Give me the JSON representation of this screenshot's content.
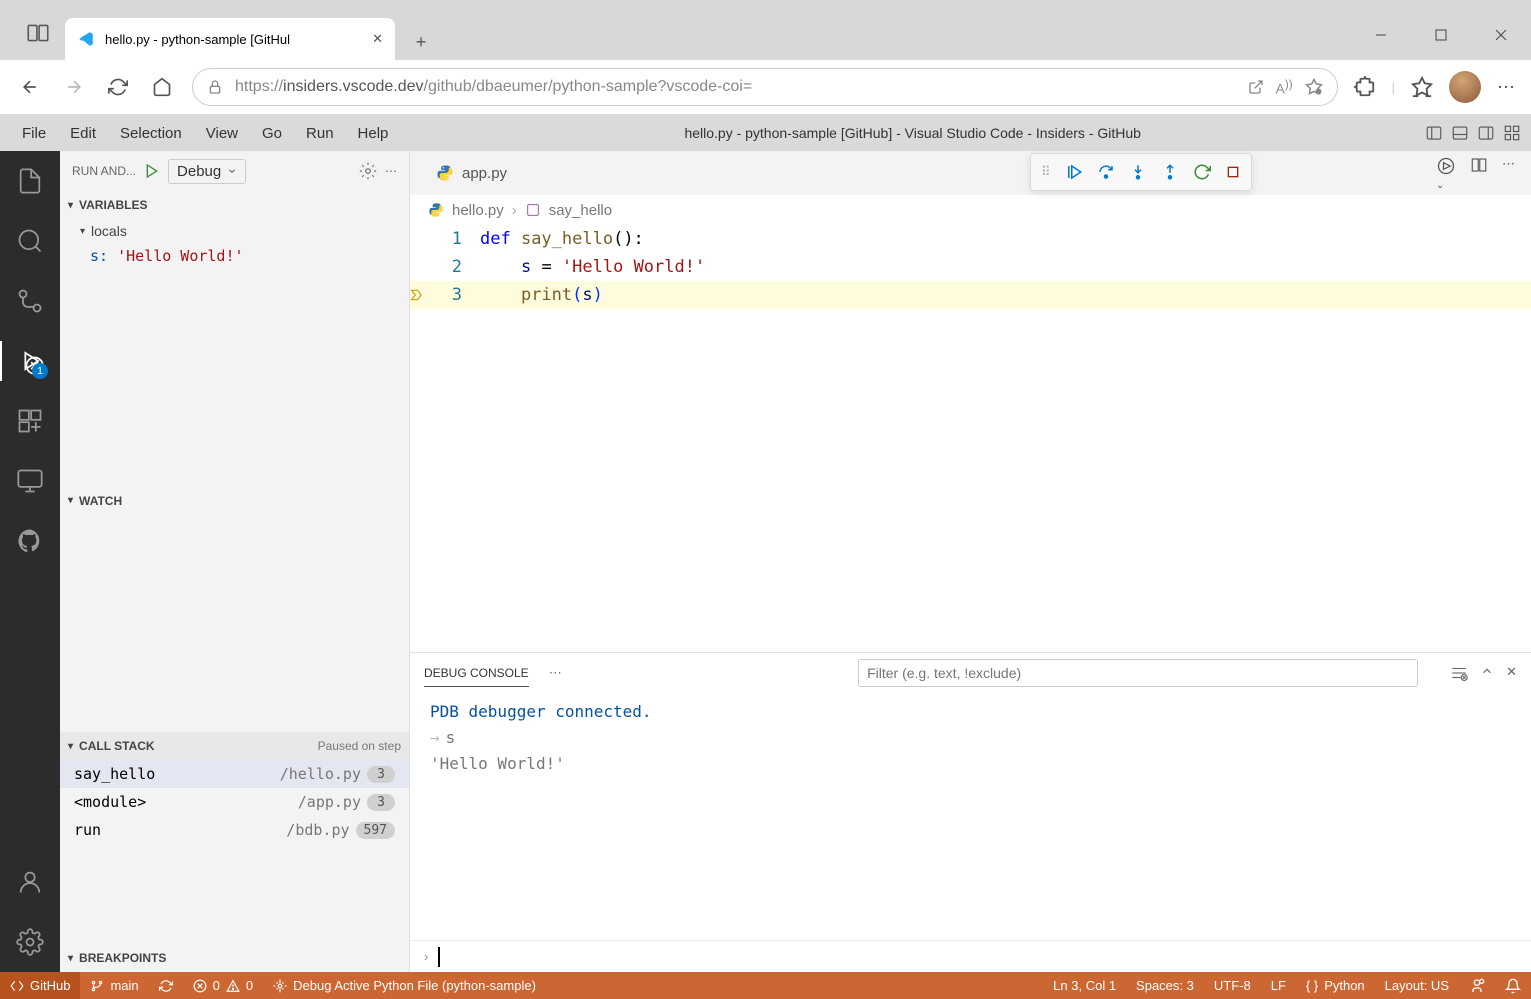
{
  "browser": {
    "tab_title": "hello.py - python-sample [GitHul",
    "url_prefix": "https://",
    "url_host": "insiders.vscode.dev",
    "url_path": "/github/dbaeumer/python-sample?vscode-coi="
  },
  "menubar": {
    "items": [
      "File",
      "Edit",
      "Selection",
      "View",
      "Go",
      "Run",
      "Help"
    ],
    "window_title": "hello.py - python-sample [GitHub] - Visual Studio Code - Insiders - GitHub"
  },
  "activity": {
    "debug_badge": "1"
  },
  "sidebar": {
    "title": "RUN AND...",
    "config": "Debug",
    "sections": {
      "variables": "VARIABLES",
      "locals": "locals",
      "var_s_name": "s:",
      "var_s_val": " 'Hello World!'",
      "watch": "WATCH",
      "callstack": "CALL STACK",
      "callstack_status": "Paused on step",
      "frames": [
        {
          "name": "say_hello",
          "file": "/hello.py",
          "line": "3"
        },
        {
          "name": "<module>",
          "file": "/app.py",
          "line": "3"
        },
        {
          "name": "run",
          "file": "/bdb.py",
          "line": "597"
        }
      ],
      "breakpoints": "BREAKPOINTS"
    }
  },
  "editor": {
    "tab": "app.py",
    "breadcrumb_file": "hello.py",
    "breadcrumb_symbol": "say_hello",
    "lines": {
      "l1_kw": "def ",
      "l1_fn": "say_hello",
      "l1_rest": "():",
      "l2_var": "s",
      "l2_op": " = ",
      "l2_str": "'Hello World!'",
      "l3_fn": "print",
      "l3_p1": "(",
      "l3_var": "s",
      "l3_p2": ")"
    },
    "line_numbers": [
      "1",
      "2",
      "3"
    ]
  },
  "panel": {
    "tab": "DEBUG CONSOLE",
    "filter_placeholder": "Filter (e.g. text, !exclude)",
    "out": {
      "l1": "PDB debugger connected.",
      "l2": "s",
      "l3": "'Hello World!'"
    }
  },
  "status": {
    "remote": "GitHub",
    "branch": "main",
    "errors": "0",
    "warnings": "0",
    "debug": "Debug Active Python File (python-sample)",
    "pos": "Ln 3, Col 1",
    "spaces": "Spaces: 3",
    "encoding": "UTF-8",
    "eol": "LF",
    "lang": "Python",
    "layout": "Layout: US"
  }
}
